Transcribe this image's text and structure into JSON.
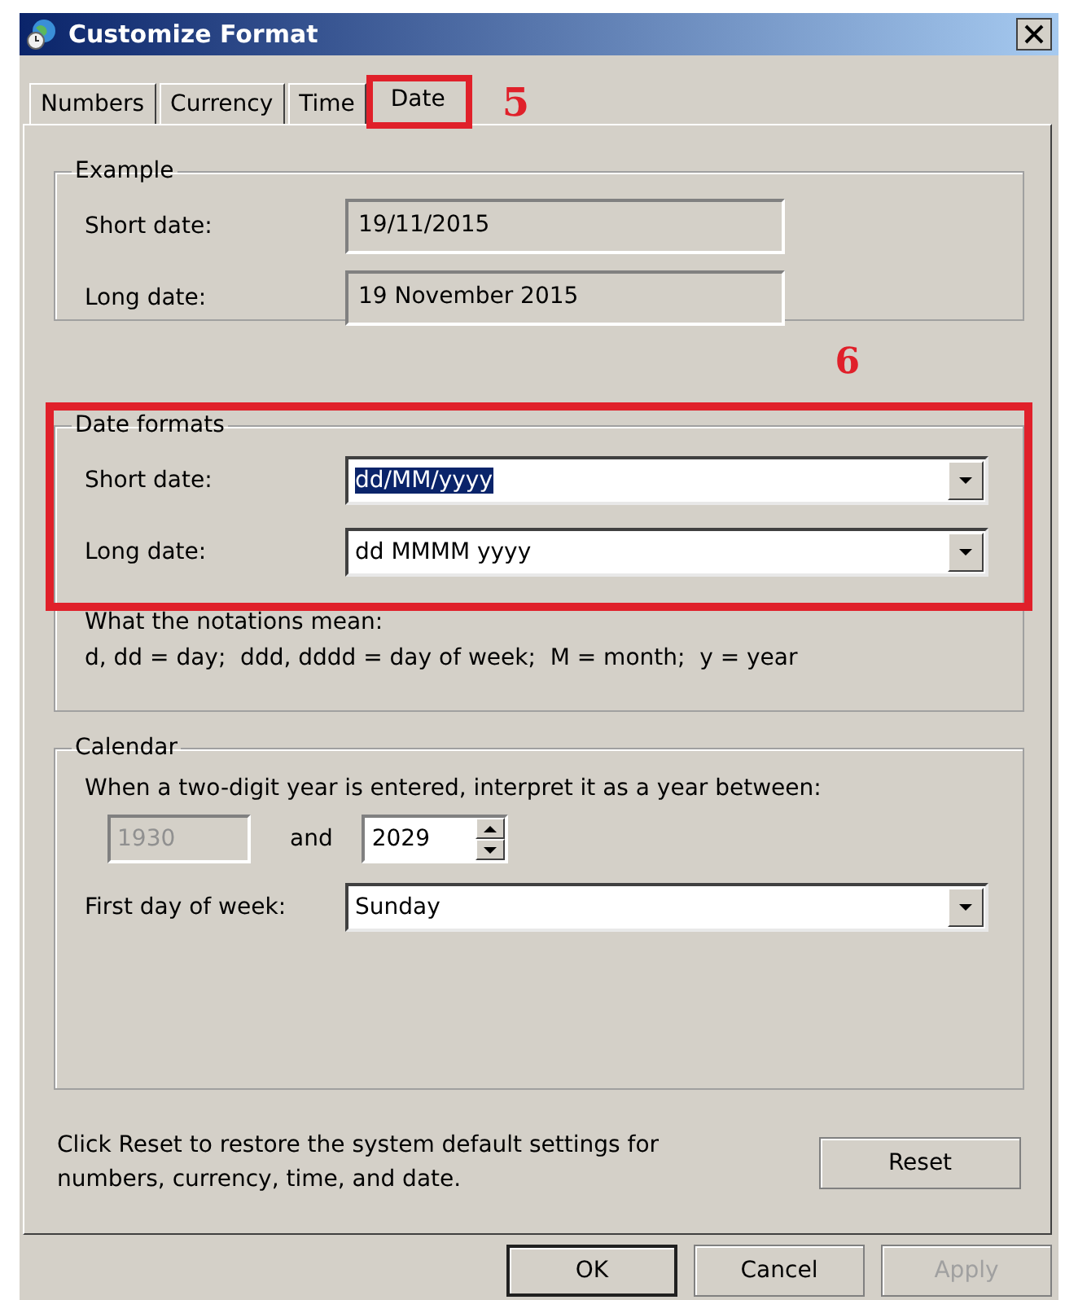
{
  "window": {
    "title": "Customize Format"
  },
  "tabs": [
    {
      "label": "Numbers",
      "selected": false,
      "annotated": false
    },
    {
      "label": "Currency",
      "selected": false,
      "annotated": false
    },
    {
      "label": "Time",
      "selected": false,
      "annotated": false
    },
    {
      "label": "Date",
      "selected": true,
      "annotated": true
    }
  ],
  "tab_annotation": "5",
  "example": {
    "title": "Example",
    "rows": [
      {
        "label": "Short date:",
        "value": "19/11/2015"
      },
      {
        "label": "Long date:",
        "value": "19 November 2015"
      }
    ]
  },
  "date_formats": {
    "title": "Date formats",
    "annotation": "6",
    "rows": [
      {
        "label": "Short date:",
        "value": "dd/MM/yyyy",
        "highlighted": true
      },
      {
        "label": "Long date:",
        "value": "dd MMMM yyyy",
        "highlighted": false
      }
    ],
    "notes": [
      "What the notations mean:",
      "d, dd = day;  ddd, dddd = day of week;  M = month;  y = year"
    ]
  },
  "calendar": {
    "title": "Calendar",
    "prompt": "When a two-digit year is entered, interpret it as a year between:",
    "year_from": {
      "value": "1930",
      "disabled": true
    },
    "joiner": "and",
    "year_to": {
      "value": "2029",
      "disabled": false
    },
    "first_day": {
      "label": "First day of week:",
      "value": "Sunday"
    }
  },
  "reset": {
    "text": "Click Reset to restore the system default settings for numbers, currency, time, and date.",
    "button": "Reset"
  },
  "buttons": [
    {
      "label": "OK",
      "disabled": false,
      "default": true
    },
    {
      "label": "Cancel",
      "disabled": false,
      "default": false
    },
    {
      "label": "Apply",
      "disabled": true,
      "default": false
    }
  ]
}
